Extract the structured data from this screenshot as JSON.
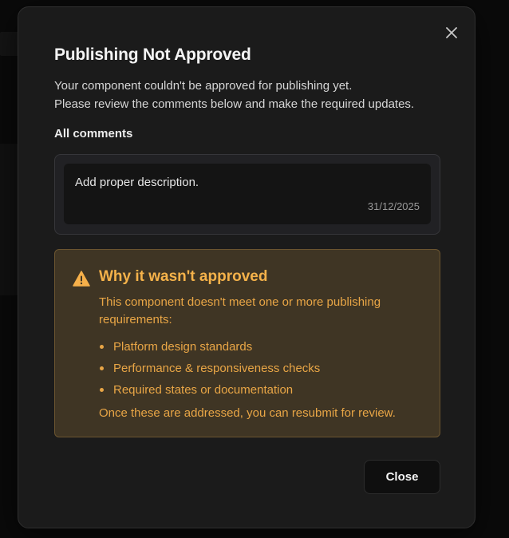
{
  "dialog": {
    "title": "Publishing Not Approved",
    "subtitle_lines": [
      "Your component couldn't be approved for publishing yet.",
      "Please review the comments below and make the required updates."
    ],
    "close_icon": "close-icon",
    "comments": {
      "label": "All comments",
      "items": [
        {
          "text": "Add proper description.",
          "date": "31/12/2025"
        }
      ]
    },
    "warning": {
      "icon": "warning-icon",
      "title": "Why it wasn't approved",
      "description": "This component doesn't meet one or more publishing requirements:",
      "items": [
        "Platform design standards",
        "Performance & responsiveness checks",
        "Required states or documentation"
      ],
      "footer": "Once these are addressed, you can resubmit for review."
    },
    "close_button_label": "Close"
  },
  "colors": {
    "modal_bg": "#1b1b1b",
    "warning_bg": "#3f3524",
    "warning_text": "#f0ab47",
    "warning_icon": "#f6b04a"
  }
}
